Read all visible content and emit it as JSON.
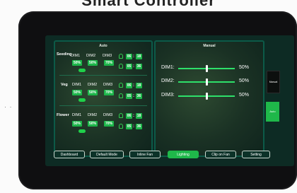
{
  "page": {
    "title": "Smart Controller",
    "decoration": "· ·"
  },
  "auto": {
    "title": "Auto",
    "groups": [
      {
        "label": "Seeding",
        "dims": [
          "DIM1",
          "DIM2",
          "DIM3"
        ],
        "values": [
          "50%",
          "50%",
          "70%"
        ],
        "on": {
          "h": "06",
          "m": "18"
        },
        "off": {
          "h": "05",
          "m": "36"
        }
      },
      {
        "label": "Veg",
        "dims": [
          "DIM1",
          "DIM2",
          "DIM3"
        ],
        "values": [
          "50%",
          "50%",
          "70%"
        ],
        "on": {
          "h": "06",
          "m": "18"
        },
        "off": {
          "h": "05",
          "m": "36"
        }
      },
      {
        "label": "Flower",
        "dims": [
          "DIM1",
          "DIM2",
          "DIM3"
        ],
        "values": [
          "50%",
          "50%",
          "70%"
        ],
        "on": {
          "h": "06",
          "m": "18"
        },
        "off": {
          "h": "05",
          "m": "36"
        }
      }
    ]
  },
  "manual": {
    "title": "Manual",
    "sliders": [
      {
        "label": "DIM1:",
        "value": "50%",
        "level": 0.5
      },
      {
        "label": "DIM2:",
        "value": "50%",
        "level": 0.5
      },
      {
        "label": "DIM3:",
        "value": "50%",
        "level": 0.5
      }
    ]
  },
  "side_tabs": {
    "manual": "Manual",
    "auto": "Auto"
  },
  "bottom_nav": {
    "dashboard": "Dashboard",
    "default_mode": "Default Mode",
    "inline_fan": "Inline Fan",
    "lighting": "Lighting",
    "clip_on_fan": "Clip on Fan",
    "setting": "Setting"
  },
  "colors": {
    "accent": "#1fb84a",
    "screen_bg": "#0d2b24",
    "panel_border": "#0c5a48"
  }
}
